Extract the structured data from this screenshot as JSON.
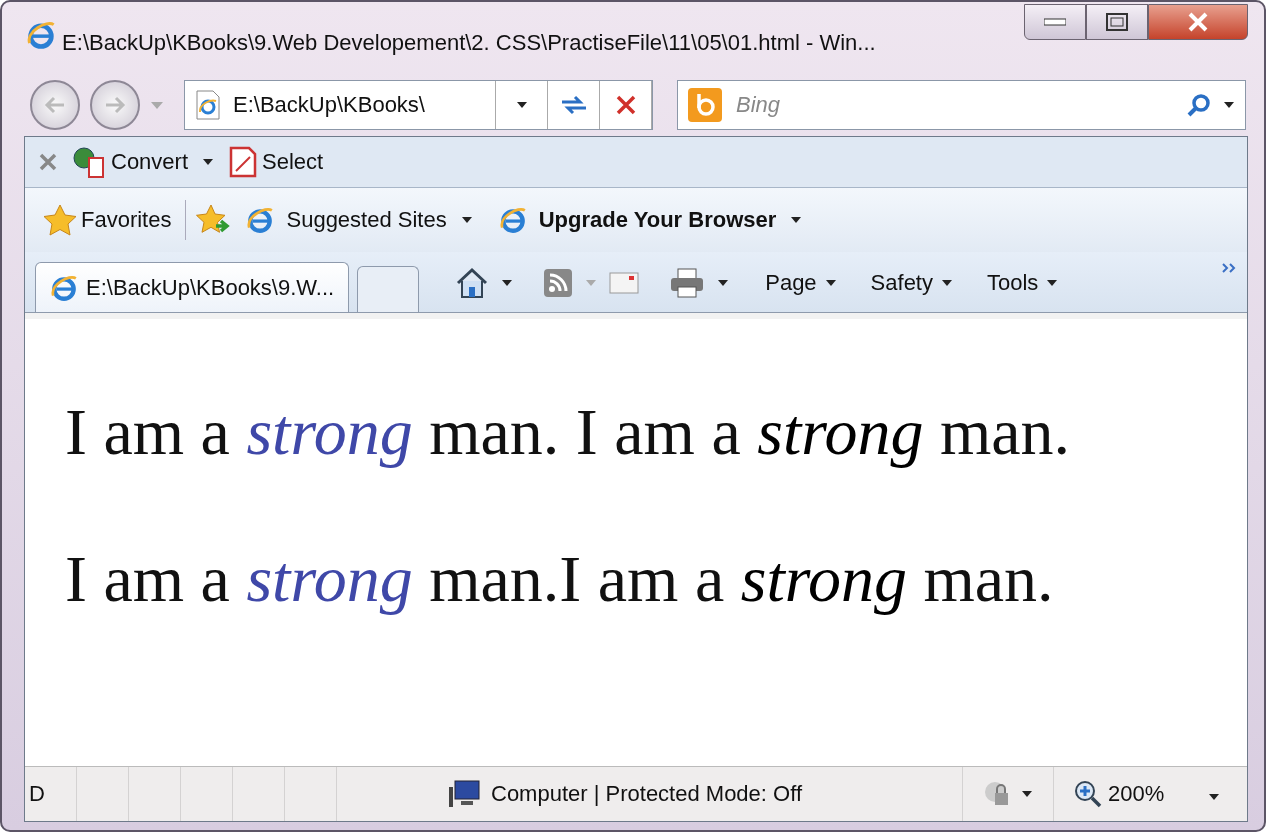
{
  "window": {
    "title": "E:\\BackUp\\KBooks\\9.Web Developement\\2. CSS\\PractiseFile\\11\\05\\01.html - Win..."
  },
  "address_bar": {
    "value": "E:\\BackUp\\KBooks\\"
  },
  "search": {
    "placeholder": "Bing"
  },
  "command_bar": {
    "items": [
      "Convert",
      "Select"
    ]
  },
  "favorites_bar": {
    "favorites": "Favorites",
    "links": [
      {
        "label": "Suggested Sites",
        "bold": false
      },
      {
        "label": "Upgrade Your Browser",
        "bold": true
      }
    ]
  },
  "tabs": [
    {
      "label": "E:\\BackUp\\KBooks\\9.W...",
      "selected": true
    }
  ],
  "menus": [
    "Page",
    "Safety",
    "Tools"
  ],
  "paragraphs": [
    [
      {
        "text": "I am a "
      },
      {
        "text": "strong",
        "italic": true,
        "color": "#3f48a8"
      },
      {
        "text": " man. I am a "
      },
      {
        "text": "strong",
        "italic": true,
        "color": "#000000"
      },
      {
        "text": " man."
      }
    ],
    [
      {
        "text": "I am a "
      },
      {
        "text": "strong",
        "italic": true,
        "color": "#3f48a8"
      },
      {
        "text": " man.I am a "
      },
      {
        "text": "strong",
        "italic": true,
        "color": "#000000"
      },
      {
        "text": " man."
      }
    ]
  ],
  "status_bar": {
    "text": "D",
    "zone": "Computer | Protected Mode: Off",
    "zoom": "200%"
  }
}
